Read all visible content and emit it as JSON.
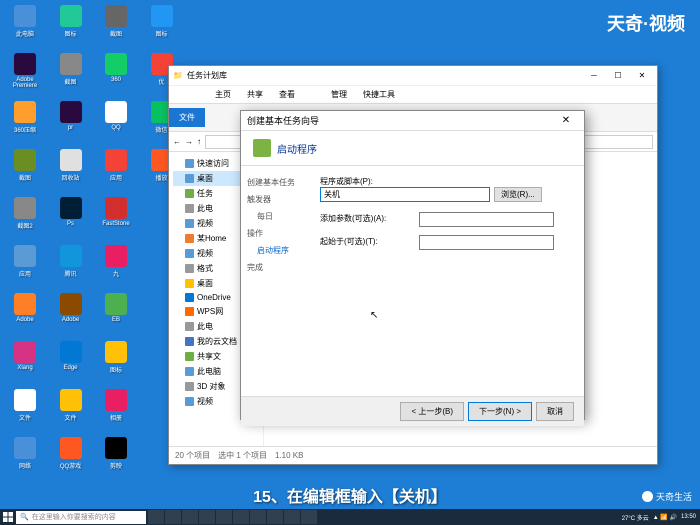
{
  "watermark": "天奇·视频",
  "watermark_bottom": "天奇生活",
  "caption": "15、在编辑框输入【关机】",
  "desktop_icons": [
    {
      "label": "此电脑",
      "color": "#4a90d9"
    },
    {
      "label": "Adobe Premiere",
      "color": "#2a0a3e"
    },
    {
      "label": "360压缩",
      "color": "#ff9e2c"
    },
    {
      "label": "截图",
      "color": "#6b8e23"
    },
    {
      "label": "截图2",
      "color": "#888"
    },
    {
      "label": "应用",
      "color": "#5a9bd5"
    },
    {
      "label": "Adobe",
      "color": "#ff7f27"
    },
    {
      "label": "Xlang",
      "color": "#d63384"
    },
    {
      "label": "文件",
      "color": "#fff"
    },
    {
      "label": "网络",
      "color": "#4a90d9"
    },
    {
      "label": "图标",
      "color": "#20c997"
    },
    {
      "label": "截图",
      "color": "#888"
    },
    {
      "label": "pr",
      "color": "#2a0a3e"
    },
    {
      "label": "回收站",
      "color": "#e0e0e0"
    },
    {
      "label": "Ps",
      "color": "#001e36"
    },
    {
      "label": "腾讯",
      "color": "#1296db"
    },
    {
      "label": "Adobe",
      "color": "#8a4a00"
    },
    {
      "label": "Edge",
      "color": "#0078d4"
    },
    {
      "label": "文件",
      "color": "#ffc107"
    },
    {
      "label": "QQ游戏",
      "color": "#ff5722"
    },
    {
      "label": "截图",
      "color": "#666"
    },
    {
      "label": "360",
      "color": "#13ce66"
    },
    {
      "label": "QQ",
      "color": "#fff"
    },
    {
      "label": "应用",
      "color": "#f44336"
    },
    {
      "label": "FastStone",
      "color": "#d32f2f"
    },
    {
      "label": "九",
      "color": "#e91e63"
    },
    {
      "label": "EB",
      "color": "#4caf50"
    },
    {
      "label": "图标",
      "color": "#ffc107"
    },
    {
      "label": "相册",
      "color": "#e91e63"
    },
    {
      "label": "剪映",
      "color": "#000"
    },
    {
      "label": "图标",
      "color": "#2196f3"
    },
    {
      "label": "优",
      "color": "#f44336"
    },
    {
      "label": "微信",
      "color": "#07c160"
    },
    {
      "label": "播放",
      "color": "#ff5722"
    }
  ],
  "explorer": {
    "title": "任务计划库",
    "ribbon": [
      "管理",
      "快捷工具"
    ],
    "file_tab": "文件",
    "sections": [
      "主页",
      "共享",
      "查看"
    ],
    "sidebar": [
      {
        "label": "快速访问",
        "sel": false,
        "ico": "#5b9bd5"
      },
      {
        "label": "桌面",
        "sel": true,
        "ico": "#5b9bd5"
      },
      {
        "label": "任务",
        "sel": false,
        "ico": "#70ad47"
      },
      {
        "label": "此电",
        "sel": false,
        "ico": "#999"
      },
      {
        "label": "视频",
        "sel": false,
        "ico": "#5b9bd5"
      },
      {
        "label": "某Home",
        "sel": false,
        "ico": "#ed7d31"
      },
      {
        "label": "视频",
        "sel": false,
        "ico": "#5b9bd5"
      },
      {
        "label": "格式",
        "sel": false,
        "ico": "#999"
      },
      {
        "label": "桌面",
        "sel": false,
        "ico": "#ffc000"
      },
      {
        "label": "OneDrive",
        "sel": false,
        "ico": "#0078d4"
      },
      {
        "label": "WPS网",
        "sel": false,
        "ico": "#ff6a00"
      },
      {
        "label": "此电",
        "sel": false,
        "ico": "#999"
      },
      {
        "label": "我的云文档",
        "sel": false,
        "ico": "#4472c4"
      },
      {
        "label": "共享文",
        "sel": false,
        "ico": "#70ad47"
      },
      {
        "label": "此电脑",
        "sel": false,
        "ico": "#5b9bd5"
      },
      {
        "label": "3D 对象",
        "sel": false,
        "ico": "#999"
      },
      {
        "label": "视频",
        "sel": false,
        "ico": "#5b9bd5"
      }
    ],
    "status": "20 个项目　选中 1 个项目　1.10 KB"
  },
  "wizard": {
    "title": "创建基本任务向导",
    "header": "启动程序",
    "nav": [
      {
        "label": "创建基本任务",
        "active": false
      },
      {
        "label": "触发器",
        "active": false
      },
      {
        "label": "每日",
        "active": false,
        "indent": true
      },
      {
        "label": "操作",
        "active": false
      },
      {
        "label": "启动程序",
        "active": true,
        "indent": true
      },
      {
        "label": "完成",
        "active": false
      }
    ],
    "program_label": "程序或脚本(P):",
    "program_value": "关机",
    "browse": "浏览(R)...",
    "args_label": "添加参数(可选)(A):",
    "args_value": "",
    "start_label": "起始于(可选)(T):",
    "start_value": "",
    "back": "< 上一步(B)",
    "next": "下一步(N) >",
    "cancel": "取消"
  },
  "taskbar": {
    "search_placeholder": "在这里输入你要搜索的内容",
    "weather": "27°C 多云",
    "time": "13:50"
  }
}
